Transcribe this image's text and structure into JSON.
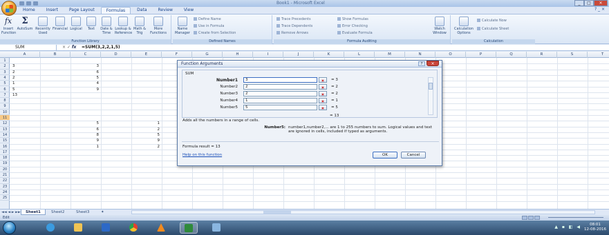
{
  "window": {
    "title": "Book1 - Microsoft Excel",
    "controls": [
      "_",
      "□",
      "×"
    ]
  },
  "ribbon": {
    "tabs": [
      "Home",
      "Insert",
      "Page Layout",
      "Formulas",
      "Data",
      "Review",
      "View"
    ],
    "active_tab": "Formulas",
    "help_glyph": "? _ ×",
    "groups": {
      "function_library": {
        "title": "Function Library",
        "buttons": [
          {
            "label": "Insert Function",
            "icon": "fx-icon"
          },
          {
            "label": "AutoSum",
            "icon": "sigma-icon"
          },
          {
            "label": "Recently Used",
            "icon": "book-icon"
          },
          {
            "label": "Financial",
            "icon": "book-icon"
          },
          {
            "label": "Logical",
            "icon": "book-icon"
          },
          {
            "label": "Text",
            "icon": "book-icon"
          },
          {
            "label": "Date & Time",
            "icon": "book-icon"
          },
          {
            "label": "Lookup & Reference",
            "icon": "book-icon"
          },
          {
            "label": "Math & Trig",
            "icon": "book-icon"
          },
          {
            "label": "More Functions",
            "icon": "book-icon"
          }
        ]
      },
      "defined_names": {
        "title": "Defined Names",
        "name_manager": "Name Manager",
        "define_name": "Define Name",
        "use_in_formula": "Use in Formula",
        "create_from_selection": "Create from Selection"
      },
      "formula_auditing": {
        "title": "Formula Auditing",
        "trace_precedents": "Trace Precedents",
        "trace_dependents": "Trace Dependents",
        "remove_arrows": "Remove Arrows",
        "show_formulas": "Show Formulas",
        "error_checking": "Error Checking",
        "evaluate_formula": "Evaluate Formula",
        "watch_window": "Watch Window"
      },
      "calculation": {
        "title": "Calculation",
        "options": "Calculation Options",
        "calculate_now": "Calculate Now",
        "calculate_sheet": "Calculate Sheet"
      }
    }
  },
  "formula_bar": {
    "name_box": "SUM",
    "cancel": "×",
    "enter": "✓",
    "fx": "fx",
    "formula": "=SUM(3,2,2,1,5)"
  },
  "grid": {
    "columns": [
      "A",
      "B",
      "C",
      "D",
      "E",
      "F",
      "G",
      "H",
      "I",
      "J",
      "K",
      "L",
      "M",
      "N",
      "O",
      "P",
      "Q",
      "R",
      "S",
      "T",
      "U"
    ],
    "rows": [
      "1",
      "2",
      "3",
      "4",
      "5",
      "6",
      "7",
      "8",
      "9",
      "10",
      "11",
      "12",
      "13",
      "14",
      "15",
      "16",
      "17",
      "18",
      "19",
      "20",
      "21",
      "22",
      "23",
      "24",
      "25"
    ],
    "selected_row": "11",
    "cells": [
      {
        "ref": "A2",
        "value": "3"
      },
      {
        "ref": "A3",
        "value": "2"
      },
      {
        "ref": "A4",
        "value": "2"
      },
      {
        "ref": "A5",
        "value": "1"
      },
      {
        "ref": "A6",
        "value": "5"
      },
      {
        "ref": "A7",
        "value": "13"
      },
      {
        "ref": "C2",
        "value": "3"
      },
      {
        "ref": "C3",
        "value": "6"
      },
      {
        "ref": "C4",
        "value": "5"
      },
      {
        "ref": "C5",
        "value": "4"
      },
      {
        "ref": "C6",
        "value": "9"
      },
      {
        "ref": "C12",
        "value": "5"
      },
      {
        "ref": "C13",
        "value": "6"
      },
      {
        "ref": "C14",
        "value": "8"
      },
      {
        "ref": "C15",
        "value": "9"
      },
      {
        "ref": "C16",
        "value": "1"
      },
      {
        "ref": "E12",
        "value": "1"
      },
      {
        "ref": "E13",
        "value": "2"
      },
      {
        "ref": "E14",
        "value": "5"
      },
      {
        "ref": "E15",
        "value": "9"
      },
      {
        "ref": "E16",
        "value": "2"
      }
    ]
  },
  "sheets": {
    "nav": "◄◄ ◄ ► ►►",
    "tabs": [
      "Sheet1",
      "Sheet2",
      "Sheet3"
    ],
    "active": "Sheet1"
  },
  "status": {
    "mode": "Edit"
  },
  "taskbar": {
    "time": "08:01",
    "date": "12-08-2016"
  },
  "dialog": {
    "title": "Function Arguments",
    "help": "?",
    "close": "×",
    "function_name": "SUM",
    "args": [
      {
        "label": "Number1",
        "value": "3",
        "result": "= 3"
      },
      {
        "label": "Number2",
        "value": "2",
        "result": "= 2"
      },
      {
        "label": "Number3",
        "value": "2",
        "result": "= 2"
      },
      {
        "label": "Number4",
        "value": "1",
        "result": "= 1"
      },
      {
        "label": "Number5",
        "value": "5",
        "result": "= 5"
      }
    ],
    "total": "= 13",
    "description": "Adds all the numbers in a range of cells.",
    "arg_desc_name": "Number5:",
    "arg_desc": "number1,number2,... are 1 to 255 numbers to sum. Logical values and text are ignored in cells, included if typed as arguments.",
    "formula_result": "Formula result =  13",
    "help_link": "Help on this function",
    "ok": "OK",
    "cancel": "Cancel"
  }
}
